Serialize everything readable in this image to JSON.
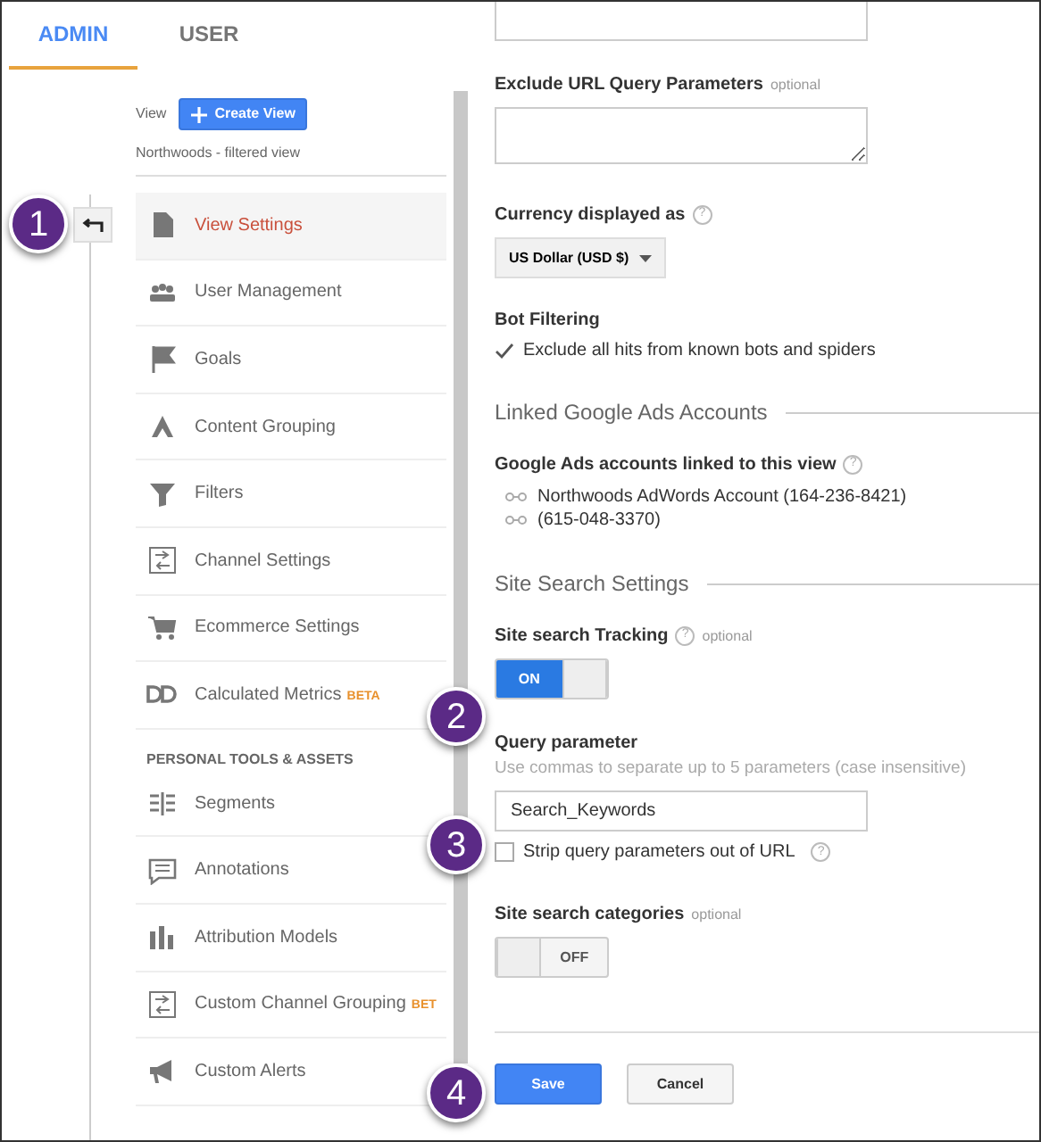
{
  "tabs": [
    {
      "label": "ADMIN",
      "selected": true
    },
    {
      "label": "USER",
      "selected": false
    }
  ],
  "nav": {
    "view_label": "View",
    "create_button": "Create View",
    "view_name": "Northwoods - filtered view",
    "items": [
      {
        "label": "View Settings",
        "selected": true
      },
      {
        "label": "User Management",
        "selected": false
      },
      {
        "label": "Goals",
        "selected": false
      },
      {
        "label": "Content Grouping",
        "selected": false
      },
      {
        "label": "Filters",
        "selected": false
      },
      {
        "label": "Channel Settings",
        "selected": false
      },
      {
        "label": "Ecommerce Settings",
        "selected": false
      },
      {
        "label": "Calculated Metrics",
        "badge": "BETA",
        "selected": false
      }
    ],
    "section_heading": "PERSONAL TOOLS & ASSETS",
    "personal_items": [
      {
        "label": "Segments",
        "selected": false
      },
      {
        "label": "Annotations",
        "selected": false
      },
      {
        "label": "Attribution Models",
        "selected": false
      },
      {
        "label": "Custom Channel Grouping",
        "badge": "BET",
        "selected": false
      },
      {
        "label": "Custom Alerts",
        "selected": false
      }
    ]
  },
  "settings": {
    "exclude_params": {
      "label": "Exclude URL Query Parameters",
      "note": "optional"
    },
    "currency": {
      "label": "Currency displayed as",
      "help": "?",
      "value": "US Dollar (USD $)"
    },
    "bot_filtering": {
      "label": "Bot Filtering",
      "option": "Exclude all hits from known bots and spiders",
      "checked": true
    },
    "linked_heading": "Linked Google Ads Accounts",
    "linked": {
      "label": "Google Ads accounts linked to this view",
      "help": "?",
      "accounts": [
        "Northwoods AdWords Account (164-236-8421)",
        "(615-048-3370)"
      ]
    },
    "site_search_heading": "Site Search Settings",
    "tracking": {
      "label": "Site search Tracking",
      "help": "?",
      "note": "optional",
      "toggle": {
        "label": "ON",
        "on": true
      }
    },
    "query": {
      "label": "Query parameter",
      "hint": "Use commas to separate up to 5 parameters (case insensitive)",
      "value": "Search_Keywords",
      "strip": {
        "label": "Strip query parameters out of URL",
        "checked": false,
        "help": "?"
      }
    },
    "categories": {
      "label": "Site search categories",
      "note": "optional",
      "toggle": {
        "label": "OFF",
        "on": false
      }
    },
    "buttons": [
      {
        "label": "Save",
        "kind": "primary"
      },
      {
        "label": "Cancel",
        "kind": "secondary"
      }
    ]
  },
  "callouts": [
    "1",
    "2",
    "3",
    "4"
  ]
}
